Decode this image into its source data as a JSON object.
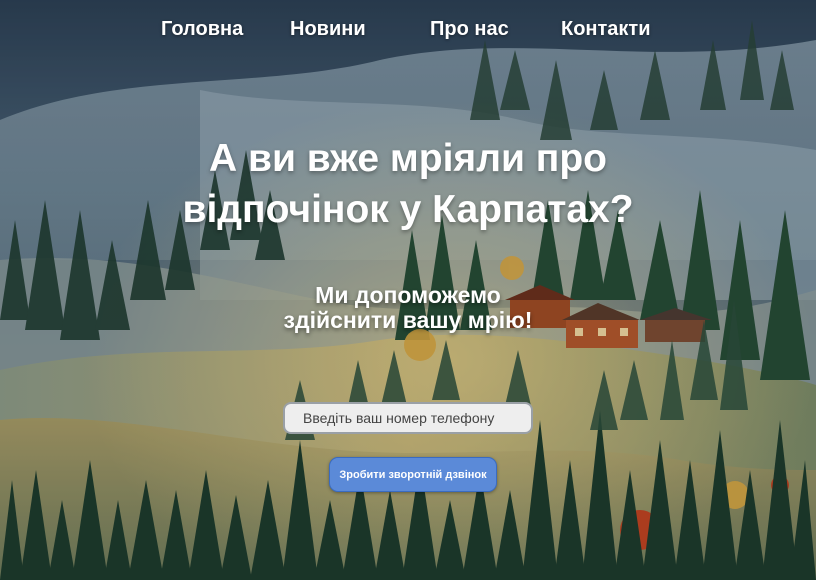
{
  "nav": {
    "items": [
      {
        "label": "Головна"
      },
      {
        "label": "Новини"
      },
      {
        "label": "Про нас"
      },
      {
        "label": "Контакти"
      }
    ]
  },
  "hero": {
    "title_line1": "А ви вже мріяли про",
    "title_line2": "відпочінок у Карпатах?",
    "subtitle_line1": "Ми допоможемо",
    "subtitle_line2": "здійснити вашу мрію!"
  },
  "form": {
    "phone_placeholder": "Введіть ваш номер телефону",
    "phone_value": "",
    "submit_label": "Зробити зворотній дзвінок"
  },
  "colors": {
    "button": "#5b8ad8",
    "text": "#ffffff",
    "input_bg": "#eeeeee"
  }
}
